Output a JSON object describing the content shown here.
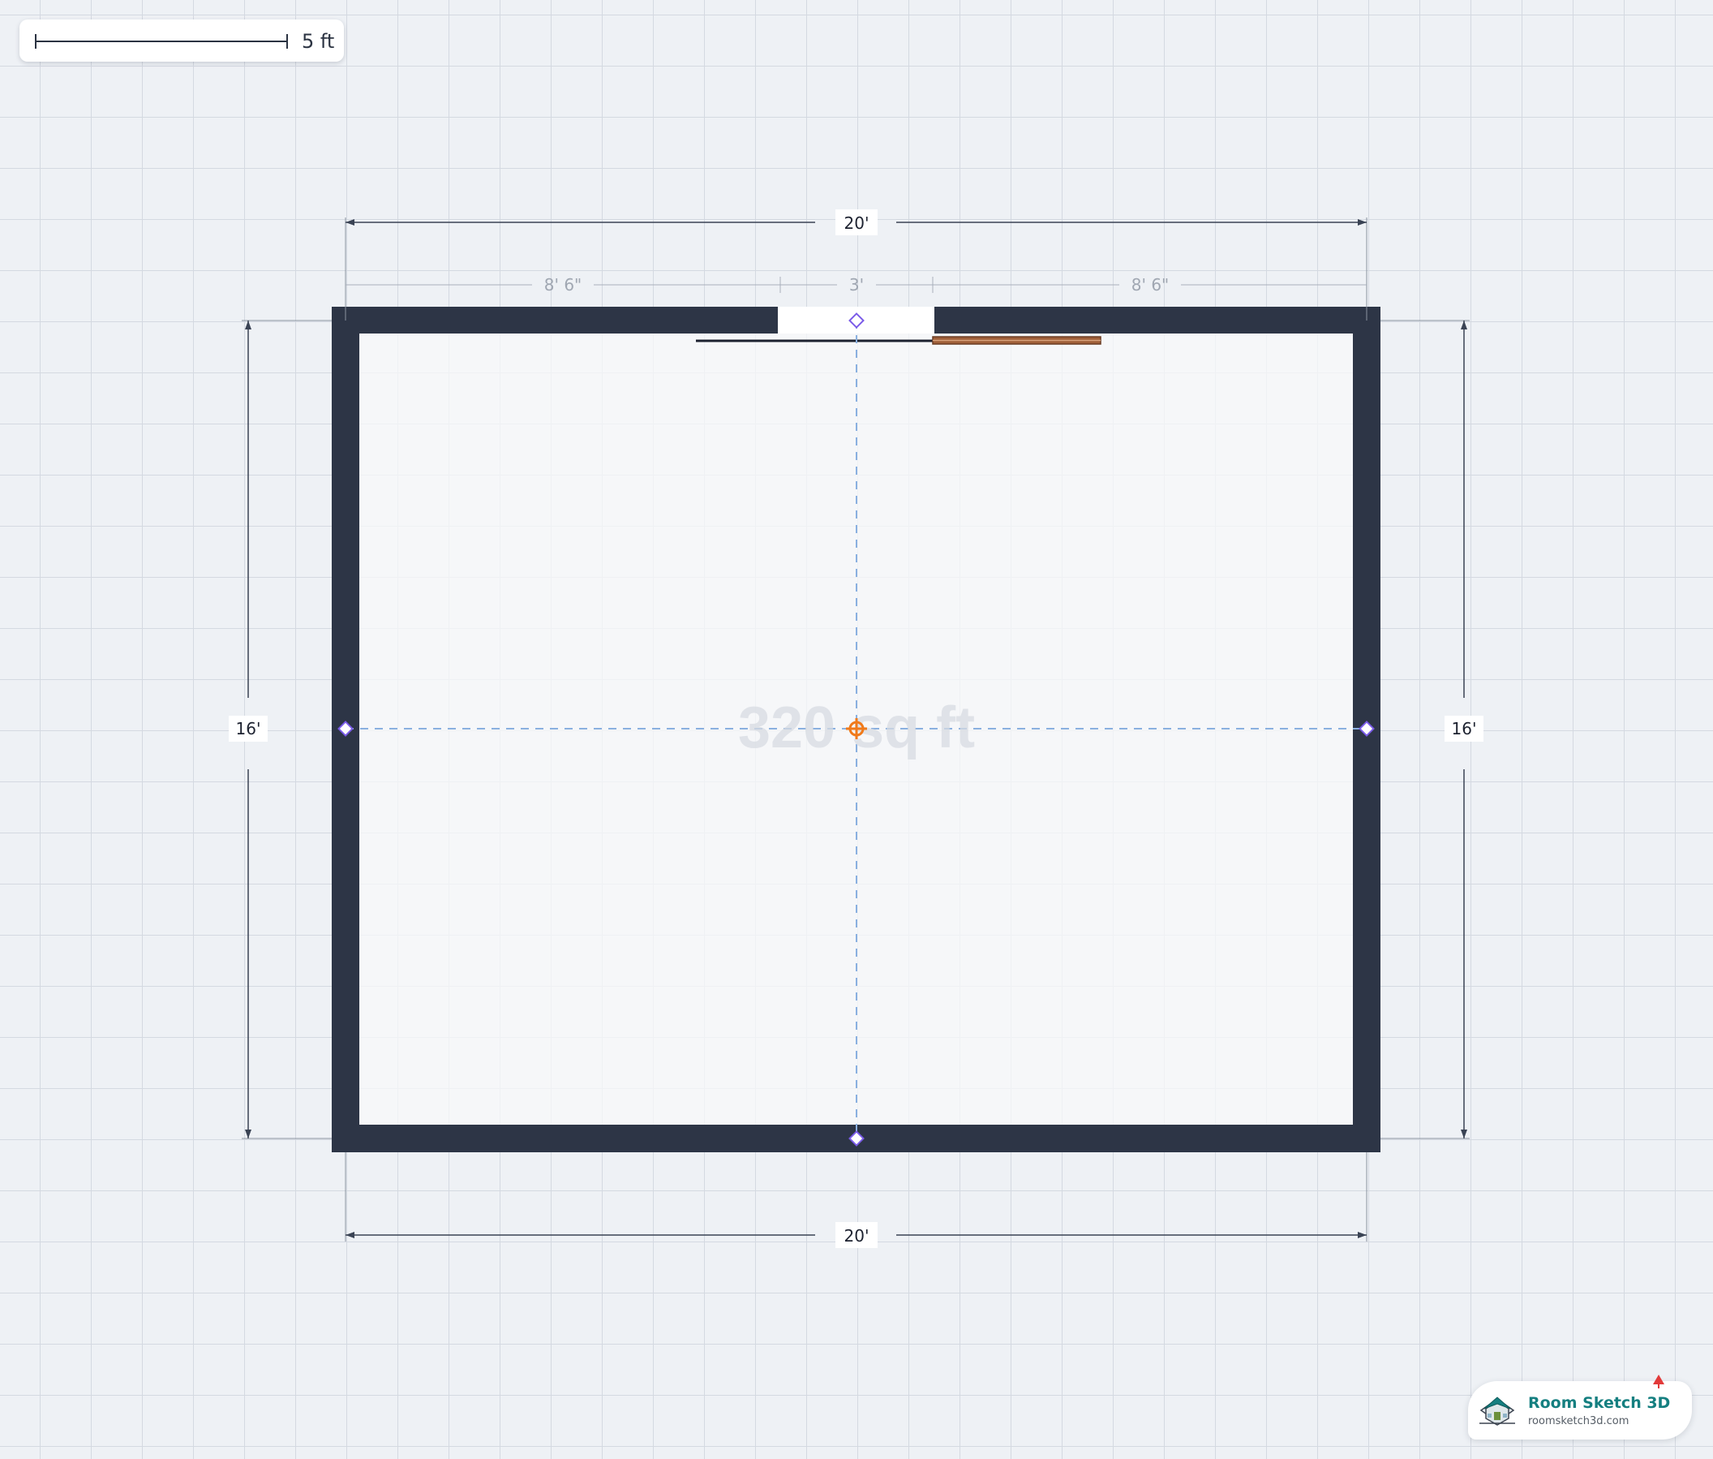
{
  "scale": {
    "label": "5 ft"
  },
  "room": {
    "area_label": "320 sq ft",
    "dimensions": {
      "top_total": "20'",
      "top_left_segment": "8' 6\"",
      "top_door_segment": "3'",
      "top_right_segment": "8' 6\"",
      "bottom_total": "20'",
      "left_height": "16'",
      "right_height": "16'"
    }
  },
  "brand": {
    "name": "Room Sketch 3D",
    "url": "roomsketch3d.com"
  },
  "colors": {
    "wall": "#2d3546",
    "floor": "#f8f8fa",
    "guide": "#8ab0e0",
    "handle": "#7b5ce8",
    "center_handle": "#f07a1a",
    "door_leaf": "#a0603a",
    "brand": "#157f80",
    "dimension_line": "#3a4354",
    "segment_text": "#a0a7b2"
  },
  "icons": {
    "center": "crosshair-handle-icon",
    "wall_handle": "diamond-handle-icon",
    "brand": "house-logo-icon",
    "notification": "red-flag-icon"
  }
}
